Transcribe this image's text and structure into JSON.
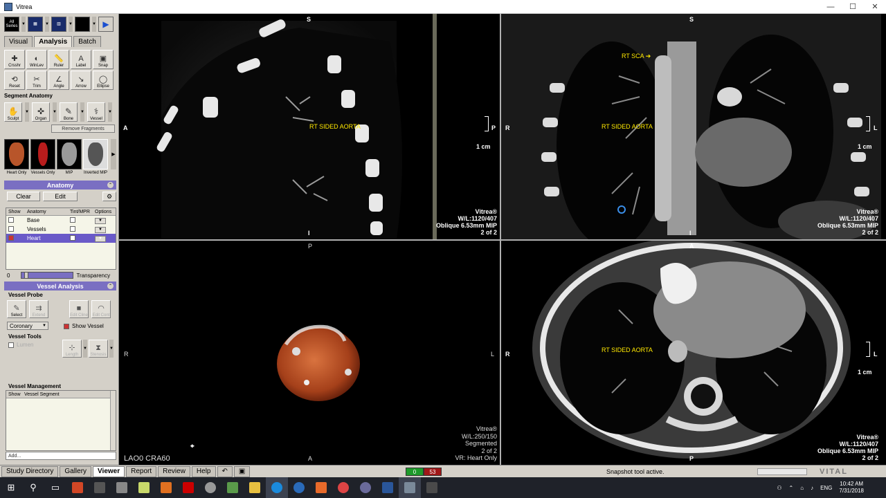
{
  "window": {
    "title": "Vitrea",
    "min": "—",
    "max": "☐",
    "close": "✕"
  },
  "toolbar": {
    "all_label": "All Series",
    "play_icon": "▶"
  },
  "tabs": [
    "Visual",
    "Analysis",
    "Batch"
  ],
  "tools": [
    {
      "label": "Crsshr",
      "glyph": "✚"
    },
    {
      "label": "WinLev",
      "glyph": "◐"
    },
    {
      "label": "Ruler",
      "glyph": "📏"
    },
    {
      "label": "Label",
      "glyph": "A"
    },
    {
      "label": "Snap",
      "glyph": "▣"
    },
    {
      "label": "Reset",
      "glyph": "⟲"
    },
    {
      "label": "Trim",
      "glyph": "✂"
    },
    {
      "label": "Angle",
      "glyph": "∠"
    },
    {
      "label": "Arrow",
      "glyph": "↘"
    },
    {
      "label": "Ellipse",
      "glyph": "◯"
    }
  ],
  "segment_anatomy": {
    "title": "Segment Anatomy",
    "tools": [
      {
        "label": "Sculpt",
        "glyph": "✋"
      },
      {
        "label": "Organ",
        "glyph": "✜"
      },
      {
        "label": "Bone",
        "glyph": "✎"
      },
      {
        "label": "Vessel",
        "glyph": "⚕"
      }
    ],
    "remove_fragments": "Remove Fragments"
  },
  "presets": [
    {
      "label": "Heart Only",
      "color": "#b8552a"
    },
    {
      "label": "Vessels Only",
      "color": "#b81c1c"
    },
    {
      "label": "MIP",
      "color": "#9a9a9a"
    },
    {
      "label": "Inverted MIP",
      "color": "#555555"
    }
  ],
  "anatomy": {
    "title": "Anatomy",
    "clear": "Clear",
    "edit": "Edit",
    "columns": [
      "Show",
      "Anatomy",
      "Tint/MPR",
      "Options"
    ],
    "rows": [
      {
        "name": "Base",
        "shown": false,
        "selected": false
      },
      {
        "name": "Vessels",
        "shown": false,
        "selected": false
      },
      {
        "name": "Heart",
        "shown": true,
        "selected": true
      }
    ],
    "transparency_value": "0",
    "transparency_label": "Transparency"
  },
  "vessel_analysis": {
    "title": "Vessel Analysis",
    "probe_title": "Vessel Probe",
    "probe_tools": [
      {
        "label": "Select",
        "enabled": true
      },
      {
        "label": "Extend",
        "enabled": false
      },
      {
        "label": "Edit Cline",
        "enabled": false
      },
      {
        "label": "Edit Cont",
        "enabled": false
      }
    ],
    "vessel_type": "Coronary",
    "show_vessel": "Show Vessel",
    "tools_title": "Vessel Tools",
    "lumen": "Lumen",
    "tool_labels": [
      "Length",
      "Stenosis"
    ]
  },
  "vessel_management": {
    "title": "Vessel Management",
    "columns": [
      "Show",
      "Vessel Segment"
    ],
    "add_placeholder": "Add..."
  },
  "viewports": {
    "top_left": {
      "top": "S",
      "left": "A",
      "right": "P",
      "bottom": "I",
      "label": "RT SIDED AORTA",
      "scale": "1 cm",
      "info": [
        "Vitrea®",
        "W/L:1120/407",
        "Oblique 6.53mm MIP",
        "2 of 2"
      ]
    },
    "top_right": {
      "top": "S",
      "left": "R",
      "right": "L",
      "bottom": "I",
      "label": "RT SIDED AORTA",
      "arrow_label": "RT SCA",
      "scale": "1 cm",
      "info": [
        "Vitrea®",
        "W/L:1120/407",
        "Oblique 6.53mm MIP",
        "2 of 2"
      ]
    },
    "bottom_left": {
      "top": "P",
      "left": "R",
      "right": "L",
      "bottom": "A",
      "orientation": "LAO0 CRA60",
      "info": [
        "Vitrea®",
        "W/L:250/150",
        "Segmented",
        "2 of 2",
        "VR: Heart Only"
      ]
    },
    "bottom_right": {
      "top": "A",
      "left": "R",
      "right": "L",
      "bottom": "P",
      "label": "RT SIDED AORTA",
      "scale": "1 cm",
      "info": [
        "Vitrea®",
        "W/L:1120/407",
        "Oblique 6.53mm MIP",
        "2 of 2"
      ]
    }
  },
  "status_tabs": [
    "Study Directory",
    "Gallery",
    "Viewer",
    "Report",
    "Review",
    "Help"
  ],
  "active_status_tab": "Viewer",
  "counters": {
    "green": "0",
    "red": "53"
  },
  "status_message": "Snapshot tool active.",
  "brand": "VITAL",
  "taskbar": {
    "lang": "ENG",
    "time": "10:42 AM",
    "date": "7/31/2018"
  }
}
